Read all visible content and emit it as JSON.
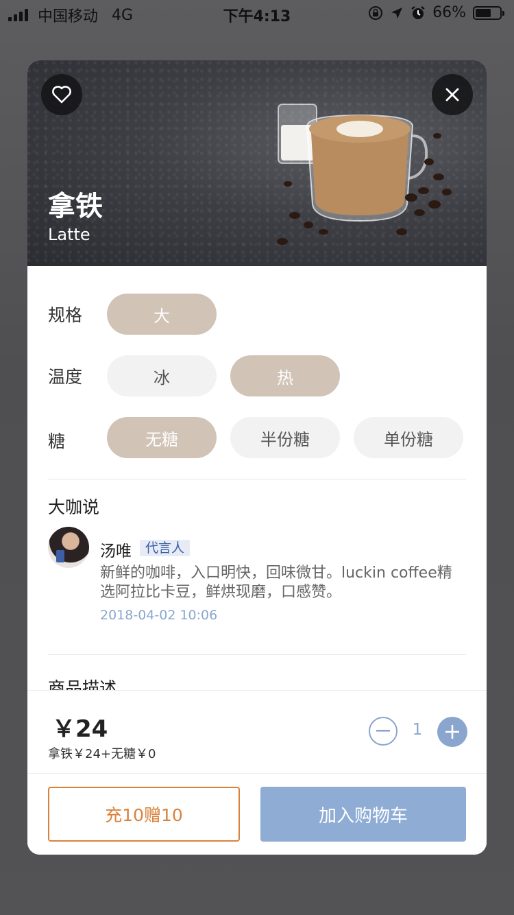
{
  "status_bar": {
    "carrier": "中国移动",
    "network": "4G",
    "time": "下午4:13",
    "battery": "66%",
    "battery_level": 0.66
  },
  "product": {
    "name": "拿铁",
    "name_en": "Latte"
  },
  "options": [
    {
      "label": "规格",
      "choices": [
        {
          "text": "大",
          "selected": true
        }
      ]
    },
    {
      "label": "温度",
      "choices": [
        {
          "text": "冰",
          "selected": false
        },
        {
          "text": "热",
          "selected": true
        }
      ]
    },
    {
      "label": "糖",
      "choices": [
        {
          "text": "无糖",
          "selected": true
        },
        {
          "text": "半份糖",
          "selected": false
        },
        {
          "text": "单份糖",
          "selected": false
        }
      ]
    }
  ],
  "comment": {
    "section_title": "大咖说",
    "author": "汤唯",
    "tag": "代言人",
    "text": "新鲜的咖啡，入口明快，回味微甘。luckin coffee精选阿拉比卡豆，鲜烘现磨，口感赞。",
    "time": "2018-04-02 10:06"
  },
  "description": {
    "section_title": "商品描述"
  },
  "footer": {
    "price": "￥24",
    "price_detail": "拿铁￥24+无糖￥0",
    "quantity": "1",
    "recharge_label": "充10赠10",
    "add_to_cart_label": "加入购物车"
  },
  "colors": {
    "selected_chip": "#d1c3b6",
    "accent_blue": "#8aa6cf",
    "accent_orange": "#d9823b"
  },
  "icons": [
    "heart-icon",
    "close-icon",
    "minus-icon",
    "plus-icon",
    "location-icon",
    "alarm-icon",
    "lock-rotation-icon"
  ]
}
